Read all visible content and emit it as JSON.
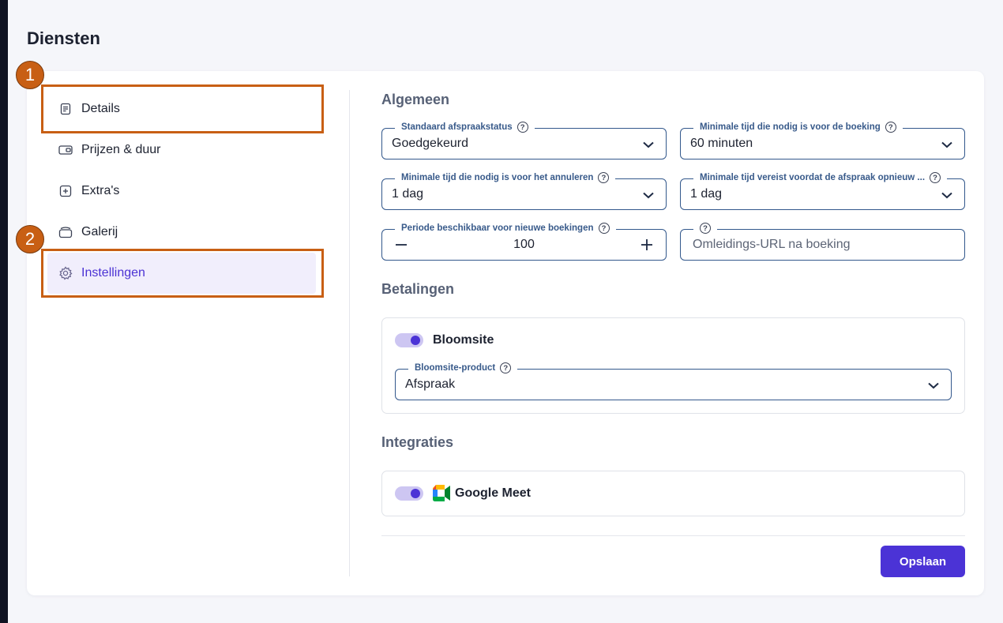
{
  "page": {
    "title": "Diensten"
  },
  "sidebar": {
    "items": [
      {
        "label": "Details",
        "icon": "document-icon"
      },
      {
        "label": "Prijzen & duur",
        "icon": "wallet-icon"
      },
      {
        "label": "Extra's",
        "icon": "plus-square-icon"
      },
      {
        "label": "Galerij",
        "icon": "gallery-icon"
      },
      {
        "label": "Instellingen",
        "icon": "gear-icon",
        "active": true
      }
    ]
  },
  "annotations": {
    "marker1": "1",
    "marker2": "2"
  },
  "general": {
    "title": "Algemeen",
    "default_status": {
      "label": "Standaard afspraakstatus",
      "value": "Goedgekeurd"
    },
    "min_time_booking": {
      "label": "Minimale tijd die nodig is voor de boeking",
      "value": "60 minuten"
    },
    "min_time_cancel": {
      "label": "Minimale tijd die nodig is voor het annuleren",
      "value": "1 dag"
    },
    "min_time_reschedule": {
      "label": "Minimale tijd vereist voordat de afspraak opnieuw ...",
      "value": "1 dag"
    },
    "period_available": {
      "label": "Periode beschikbaar voor nieuwe boekingen",
      "value": "100"
    },
    "redirect_url": {
      "placeholder": "Omleidings-URL na boeking"
    },
    "help_glyph": "?"
  },
  "payments": {
    "title": "Betalingen",
    "bloomsite": {
      "label": "Bloomsite",
      "enabled": true
    },
    "product": {
      "label": "Bloomsite-product",
      "value": "Afspraak"
    }
  },
  "integrations": {
    "title": "Integraties",
    "google_meet": {
      "label": "Google Meet",
      "enabled": true
    }
  },
  "actions": {
    "save_label": "Opslaan"
  },
  "colors": {
    "accent": "#4b33d6",
    "highlight": "#c85f14",
    "field_border": "#33588c"
  }
}
